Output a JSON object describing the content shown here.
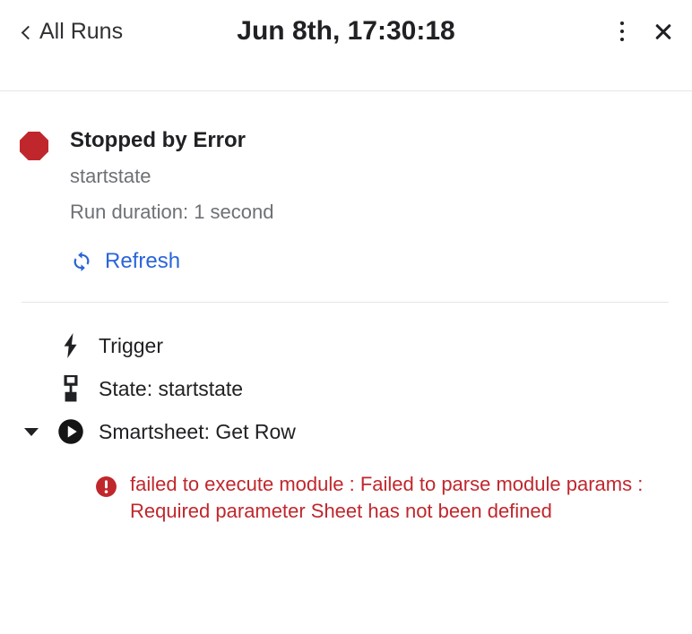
{
  "header": {
    "back_label": "All Runs",
    "back_icon": "chevron-left-icon",
    "title": "Jun 8th, 17:30:18",
    "menu_icon": "kebab-menu-icon",
    "close_icon": "close-icon"
  },
  "status": {
    "icon": "stop-octagon-icon",
    "icon_color": "#c0272d",
    "title": "Stopped by Error",
    "state_name": "startstate",
    "duration": "Run duration: 1 second",
    "refresh_label": "Refresh",
    "refresh_icon": "refresh-sync-icon",
    "refresh_color": "#2a65d8"
  },
  "steps": [
    {
      "icon": "lightning-bolt-icon",
      "label": "Trigger",
      "has_caret": false,
      "expanded": false
    },
    {
      "icon": "state-node-icon",
      "label": "State: startstate",
      "has_caret": false,
      "expanded": false
    },
    {
      "icon": "play-circle-icon",
      "label": "Smartsheet: Get Row",
      "has_caret": true,
      "expanded": true,
      "caret_icon": "chevron-down-icon"
    }
  ],
  "error": {
    "icon": "error-exclamation-icon",
    "color": "#c0272d",
    "message": "failed to execute module : Failed to parse module params : Required parameter Sheet has not been defined"
  }
}
